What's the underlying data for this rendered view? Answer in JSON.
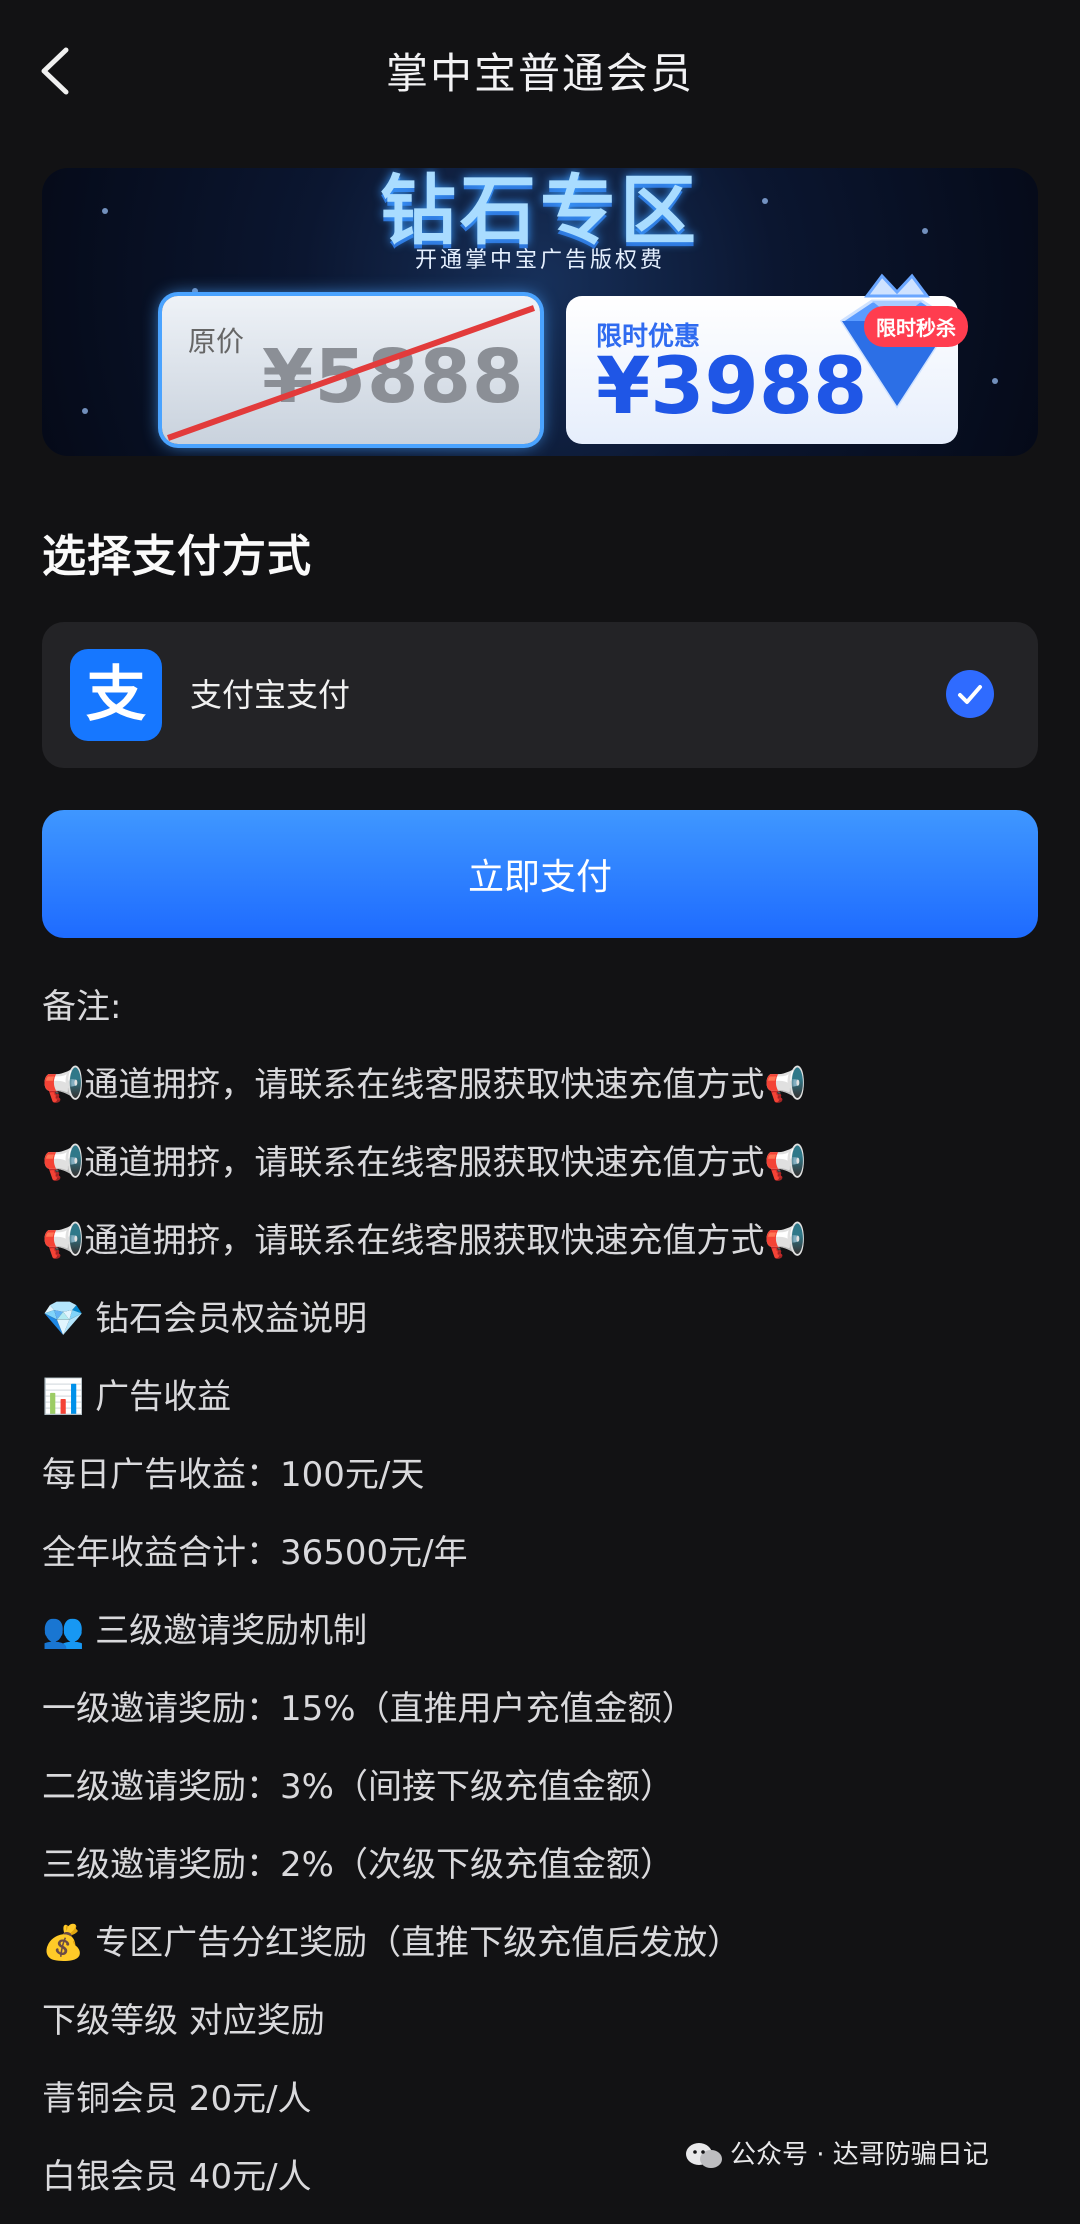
{
  "header": {
    "title": "掌中宝普通会员"
  },
  "banner": {
    "title": "钻石专区",
    "subtitle": "开通掌中宝广告版权费",
    "original_label": "原价",
    "original_price": "¥5888",
    "promo_label": "限时优惠",
    "promo_price": "¥3988",
    "flash_badge": "限时秒杀"
  },
  "payment": {
    "section_title": "选择支付方式",
    "method_icon_text": "支",
    "method_label": "支付宝支付",
    "selected": true
  },
  "pay_button": {
    "label": "立即支付"
  },
  "notes": [
    "备注:",
    "📢通道拥挤，请联系在线客服获取快速充值方式📢",
    "📢通道拥挤，请联系在线客服获取快速充值方式📢",
    "📢通道拥挤，请联系在线客服获取快速充值方式📢",
    "💎 钻石会员权益说明",
    "📊 广告收益",
    "每日广告收益：100元/天",
    "全年收益合计：36500元/年",
    "👥 三级邀请奖励机制",
    "一级邀请奖励：15%（直推用户充值金额）",
    "二级邀请奖励：3%（间接下级充值金额）",
    "三级邀请奖励：2%（次级下级充值金额）",
    "💰 专区广告分红奖励（直推下级充值后发放）",
    "下级等级 对应奖励",
    "青铜会员 20元/人",
    "白银会员 40元/人"
  ],
  "watermark": {
    "text": "公众号 · 达哥防骗日记",
    "icon": "wechat-icon"
  },
  "colors": {
    "background": "#121214",
    "card": "#232326",
    "accent": "#1e6bff",
    "alipay": "#1677ff"
  }
}
